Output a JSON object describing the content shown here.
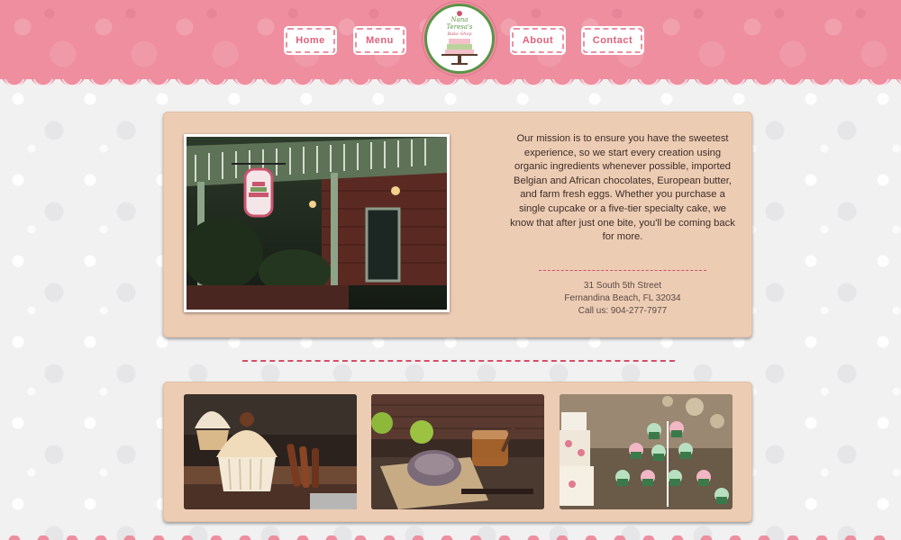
{
  "header": {
    "nav": {
      "home": "Home",
      "menu": "Menu",
      "about": "About",
      "contact": "Contact"
    },
    "logo": {
      "icon": "cake-stand-icon",
      "line1": "Nana",
      "line2": "Teresa's",
      "line3": "Bake Shop"
    },
    "colors": {
      "header_pink": "#ee8e9f",
      "nav_text": "#e0607a",
      "logo_ring": "#5a9447"
    }
  },
  "about": {
    "photo_alt": "storefront-with-hanging-sign",
    "mission_text": "Our mission is to ensure you have the sweetest experience, so we start every creation using organic ingredients whenever possible, imported Belgian and African chocolates, European butter, and farm fresh eggs. Whether you purchase a single cupcake or a five-tier specialty cake, we know that after just one bite, you'll be coming back for more.",
    "address_line1": "31 South 5th Street",
    "address_line2": "Fernandina Beach, FL 32034",
    "phone": "Call us: 904-277-7977"
  },
  "gallery": {
    "items": [
      {
        "name": "cupcakes-with-cinnamon"
      },
      {
        "name": "pastry-with-apples"
      },
      {
        "name": "cupcake-tower-and-cake"
      }
    ]
  },
  "colors": {
    "panel_bg": "#edccb4",
    "divider": "#d44e67"
  }
}
